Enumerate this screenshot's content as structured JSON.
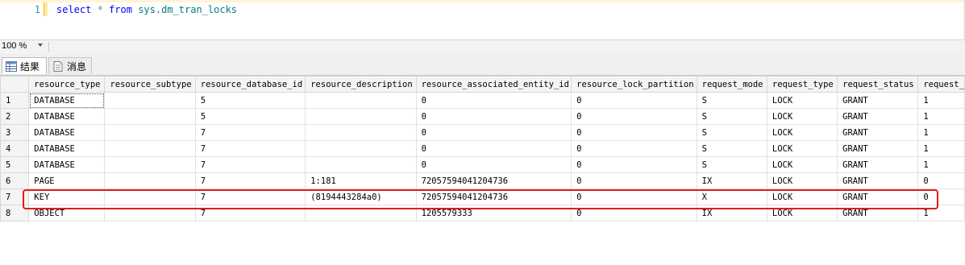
{
  "editor": {
    "line_number": "1",
    "query": {
      "kw1": "select",
      "star": "*",
      "kw2": "from",
      "object": "sys.dm_tran_locks"
    }
  },
  "zoom": {
    "value": "100 %"
  },
  "tabs": [
    {
      "label": "结果",
      "icon": "grid-icon",
      "active": true
    },
    {
      "label": "消息",
      "icon": "message-icon",
      "active": false
    }
  ],
  "grid": {
    "columns": [
      "resource_type",
      "resource_subtype",
      "resource_database_id",
      "resource_description",
      "resource_associated_entity_id",
      "resource_lock_partition",
      "request_mode",
      "request_type",
      "request_status",
      "request_"
    ],
    "rows": [
      [
        "1",
        "DATABASE",
        "",
        "5",
        "",
        "0",
        "0",
        "S",
        "LOCK",
        "GRANT",
        "1"
      ],
      [
        "2",
        "DATABASE",
        "",
        "5",
        "",
        "0",
        "0",
        "S",
        "LOCK",
        "GRANT",
        "1"
      ],
      [
        "3",
        "DATABASE",
        "",
        "7",
        "",
        "0",
        "0",
        "S",
        "LOCK",
        "GRANT",
        "1"
      ],
      [
        "4",
        "DATABASE",
        "",
        "7",
        "",
        "0",
        "0",
        "S",
        "LOCK",
        "GRANT",
        "1"
      ],
      [
        "5",
        "DATABASE",
        "",
        "7",
        "",
        "0",
        "0",
        "S",
        "LOCK",
        "GRANT",
        "1"
      ],
      [
        "6",
        "PAGE",
        "",
        "7",
        "1:181",
        "72057594041204736",
        "0",
        "IX",
        "LOCK",
        "GRANT",
        "0"
      ],
      [
        "7",
        "KEY",
        "",
        "7",
        "(8194443284a0)",
        "72057594041204736",
        "0",
        "X",
        "LOCK",
        "GRANT",
        "0"
      ],
      [
        "8",
        "OBJECT",
        "",
        "7",
        "",
        "1205579333",
        "0",
        "IX",
        "LOCK",
        "GRANT",
        "1"
      ]
    ],
    "highlighted_row": "7",
    "highlight_color": "#e51a1a"
  }
}
